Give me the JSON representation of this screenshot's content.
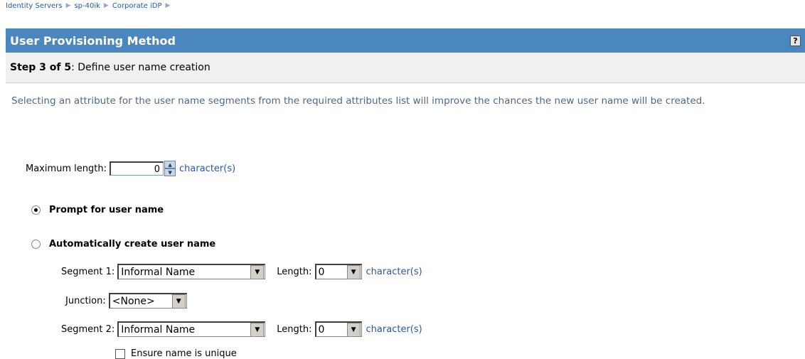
{
  "breadcrumb": [
    "Identity Servers",
    "sp-40ik",
    "Corporate iDP"
  ],
  "title": "User Provisioning Method",
  "help_label": "?",
  "step": {
    "prefix": "Step 3 of 5",
    "text": ": Define user name creation"
  },
  "description": "Selecting an attribute for the user name segments from the required attributes list will improve the chances the new user name will be created.",
  "max_length": {
    "label": "Maximum length:",
    "value": "0",
    "unit": "character(s)"
  },
  "options": [
    {
      "label": "Prompt for user name",
      "selected": true
    },
    {
      "label": "Automatically create user name",
      "selected": false
    }
  ],
  "segment1": {
    "label": "Segment 1:",
    "value": "Informal Name",
    "length_label": "Length:",
    "length_value": "0",
    "unit": "character(s)"
  },
  "junction": {
    "label": "Junction:",
    "value": "<None>"
  },
  "segment2": {
    "label": "Segment 2:",
    "value": "Informal Name",
    "length_label": "Length:",
    "length_value": "0",
    "unit": "character(s)"
  },
  "unique": {
    "label": "Ensure name is unique"
  }
}
